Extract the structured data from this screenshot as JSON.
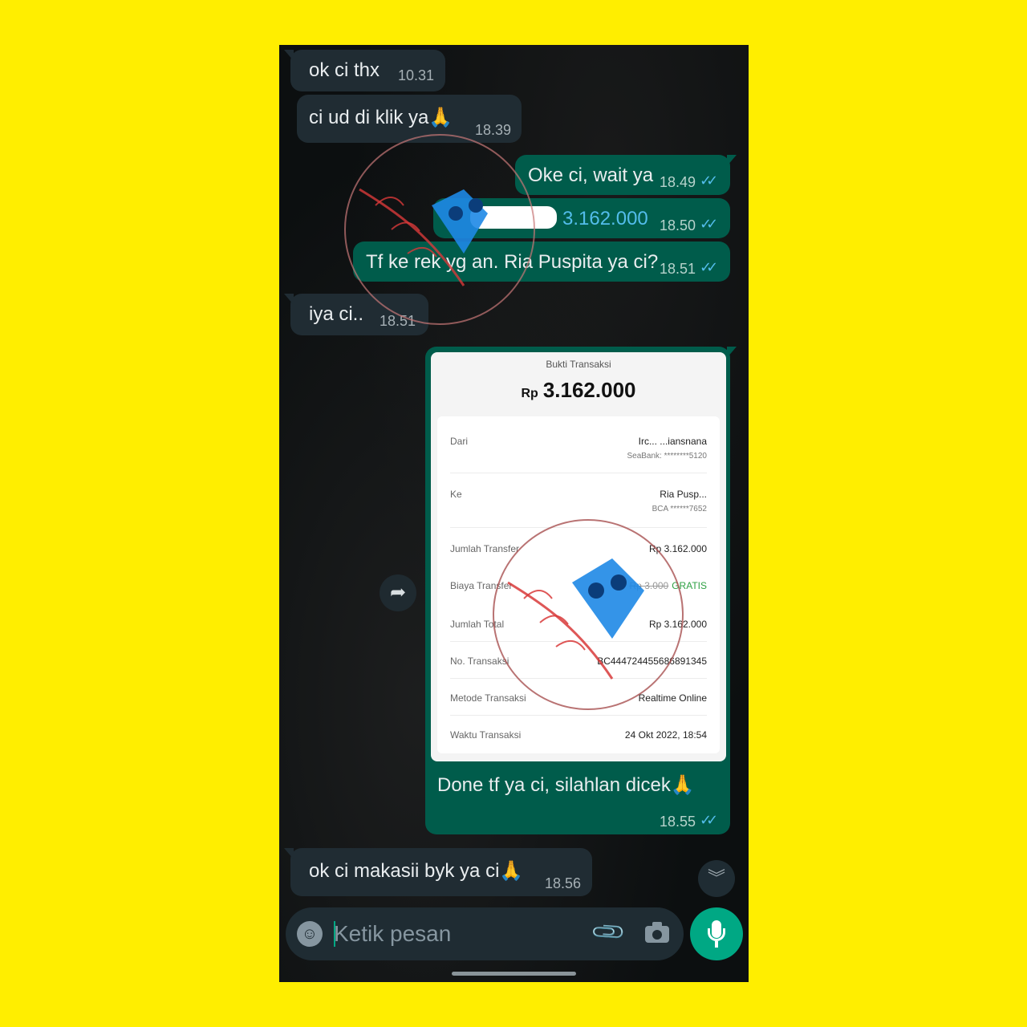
{
  "messages": [
    {
      "text": "ok ci thx",
      "time": "10.31",
      "dir": "in"
    },
    {
      "text": "ci ud di klik ya🙏",
      "time": "18.39",
      "dir": "in"
    },
    {
      "text": "Oke ci, wait ya",
      "time": "18.49",
      "dir": "out"
    },
    {
      "text": "3.162.000",
      "time": "18.50",
      "dir": "out"
    },
    {
      "text": "Tf ke rek yg an. Ria Puspita ya ci?",
      "time": "18.51",
      "dir": "out"
    },
    {
      "text": "iya ci..",
      "time": "18.51",
      "dir": "in"
    },
    {
      "text": "Done tf ya ci, silahlan dicek🙏",
      "time": "18.55",
      "dir": "out"
    },
    {
      "text": "ok ci makasii byk ya ci🙏",
      "time": "18.56",
      "dir": "in"
    }
  ],
  "receipt": {
    "title": "Bukti Transaksi",
    "currency": "Rp",
    "amount": "3.162.000",
    "rows": {
      "dari_label": "Dari",
      "dari_value": "Irc...  ...iansnana",
      "dari_bank": "SeaBank: ********5120",
      "ke_label": "Ke",
      "ke_value": "Ria Pusp...",
      "ke_bank": "BCA ******7652",
      "jumlah_label": "Jumlah Transfer",
      "jumlah_value": "Rp 3.162.000",
      "biaya_label": "Biaya Transfer",
      "biaya_strike": "Rp 3.000",
      "biaya_value": "GRATIS",
      "total_label": "Jumlah Total",
      "total_value": "Rp 3.162.000",
      "no_label": "No. Transaksi",
      "no_value": "BC444724455686891345",
      "metode_label": "Metode Transaksi",
      "metode_value": "Realtime Online",
      "waktu_label": "Waktu Transaksi",
      "waktu_value": "24 Okt 2022, 18:54"
    }
  },
  "input": {
    "placeholder": "Ketik pesan"
  },
  "icons": {
    "emoji": "emoji-icon",
    "attach": "paperclip-icon",
    "camera": "camera-icon",
    "mic": "microphone-icon",
    "forward": "forward-icon",
    "scroll": "double-chevron-down-icon"
  },
  "colors": {
    "page_bg": "#ffee00",
    "chat_bg": "#0b141a",
    "incoming": "#202c33",
    "outgoing": "#005c4b",
    "accent": "#00a884",
    "ticks": "#53bdeb"
  }
}
